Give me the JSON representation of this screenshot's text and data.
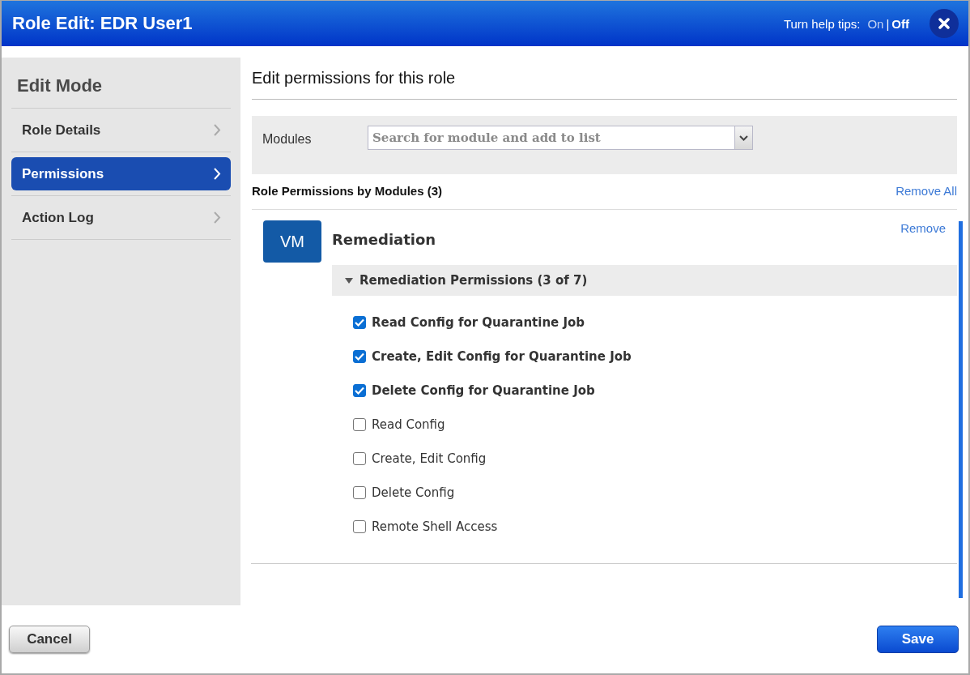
{
  "window": {
    "title": "Role Edit: EDR User1"
  },
  "help_tips": {
    "label": "Turn help tips:",
    "options": [
      {
        "label": "On",
        "selected": false
      },
      {
        "label": "Off",
        "selected": true
      }
    ],
    "separator": "|"
  },
  "sidebar": {
    "title": "Edit Mode",
    "items": [
      {
        "label": "Role Details",
        "selected": false
      },
      {
        "label": "Permissions",
        "selected": true
      },
      {
        "label": "Action Log",
        "selected": false
      }
    ]
  },
  "main": {
    "heading": "Edit permissions for this role",
    "modules_field": {
      "label": "Modules",
      "placeholder": "Search for module and add to list"
    },
    "section_title": "Role Permissions by Modules (3)",
    "remove_all": "Remove All",
    "modules": [
      {
        "badge": "VM",
        "name": "Remediation",
        "remove": "Remove",
        "group": {
          "label": "Remediation Permissions (3 of 7)",
          "expanded": true,
          "permissions": [
            {
              "label": "Read Config for Quarantine Job",
              "checked": true
            },
            {
              "label": "Create, Edit Config for Quarantine Job",
              "checked": true
            },
            {
              "label": "Delete Config for Quarantine Job",
              "checked": true
            },
            {
              "label": "Read Config",
              "checked": false
            },
            {
              "label": "Create, Edit Config",
              "checked": false
            },
            {
              "label": "Delete Config",
              "checked": false
            },
            {
              "label": "Remote Shell Access",
              "checked": false
            }
          ]
        }
      }
    ]
  },
  "buttons": {
    "cancel": "Cancel",
    "save": "Save"
  }
}
